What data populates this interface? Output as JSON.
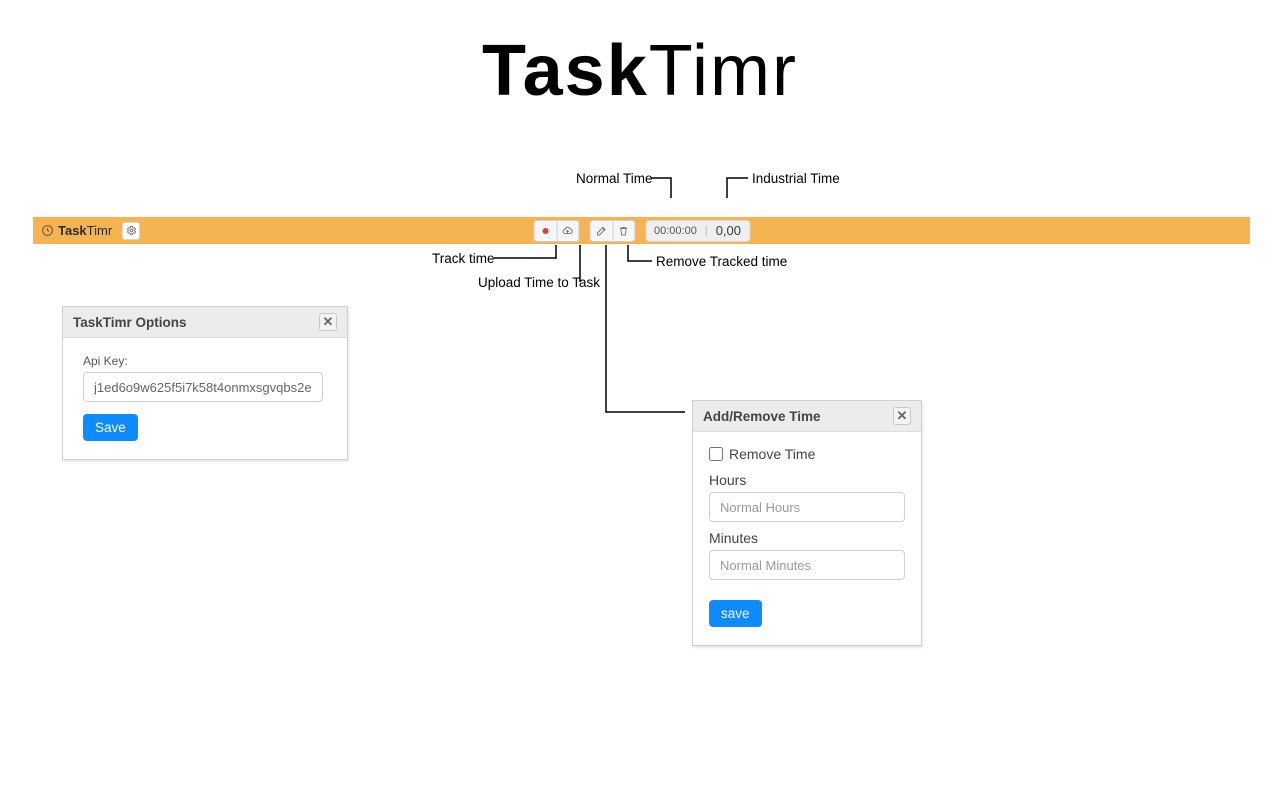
{
  "brand": {
    "bold": "Task",
    "light": "Timr"
  },
  "toolbar": {
    "clock_time": "00:00:00",
    "industrial_time": "0,00"
  },
  "annotations": {
    "normal_time": "Normal Time",
    "industrial_time": "Industrial Time",
    "track_time": "Track time",
    "upload_time": "Upload Time to Task",
    "remove_tracked": "Remove Tracked time"
  },
  "options_dialog": {
    "title": "TaskTimr Options",
    "api_key_label": "Api Key:",
    "api_key_value": "j1ed6o9w625f5i7k58t4onmxsgvqbs2e",
    "save_label": "Save"
  },
  "add_remove_dialog": {
    "title": "Add/Remove Time",
    "remove_time_label": "Remove Time",
    "hours_label": "Hours",
    "hours_placeholder": "Normal Hours",
    "minutes_label": "Minutes",
    "minutes_placeholder": "Normal Minutes",
    "save_label": "save"
  }
}
